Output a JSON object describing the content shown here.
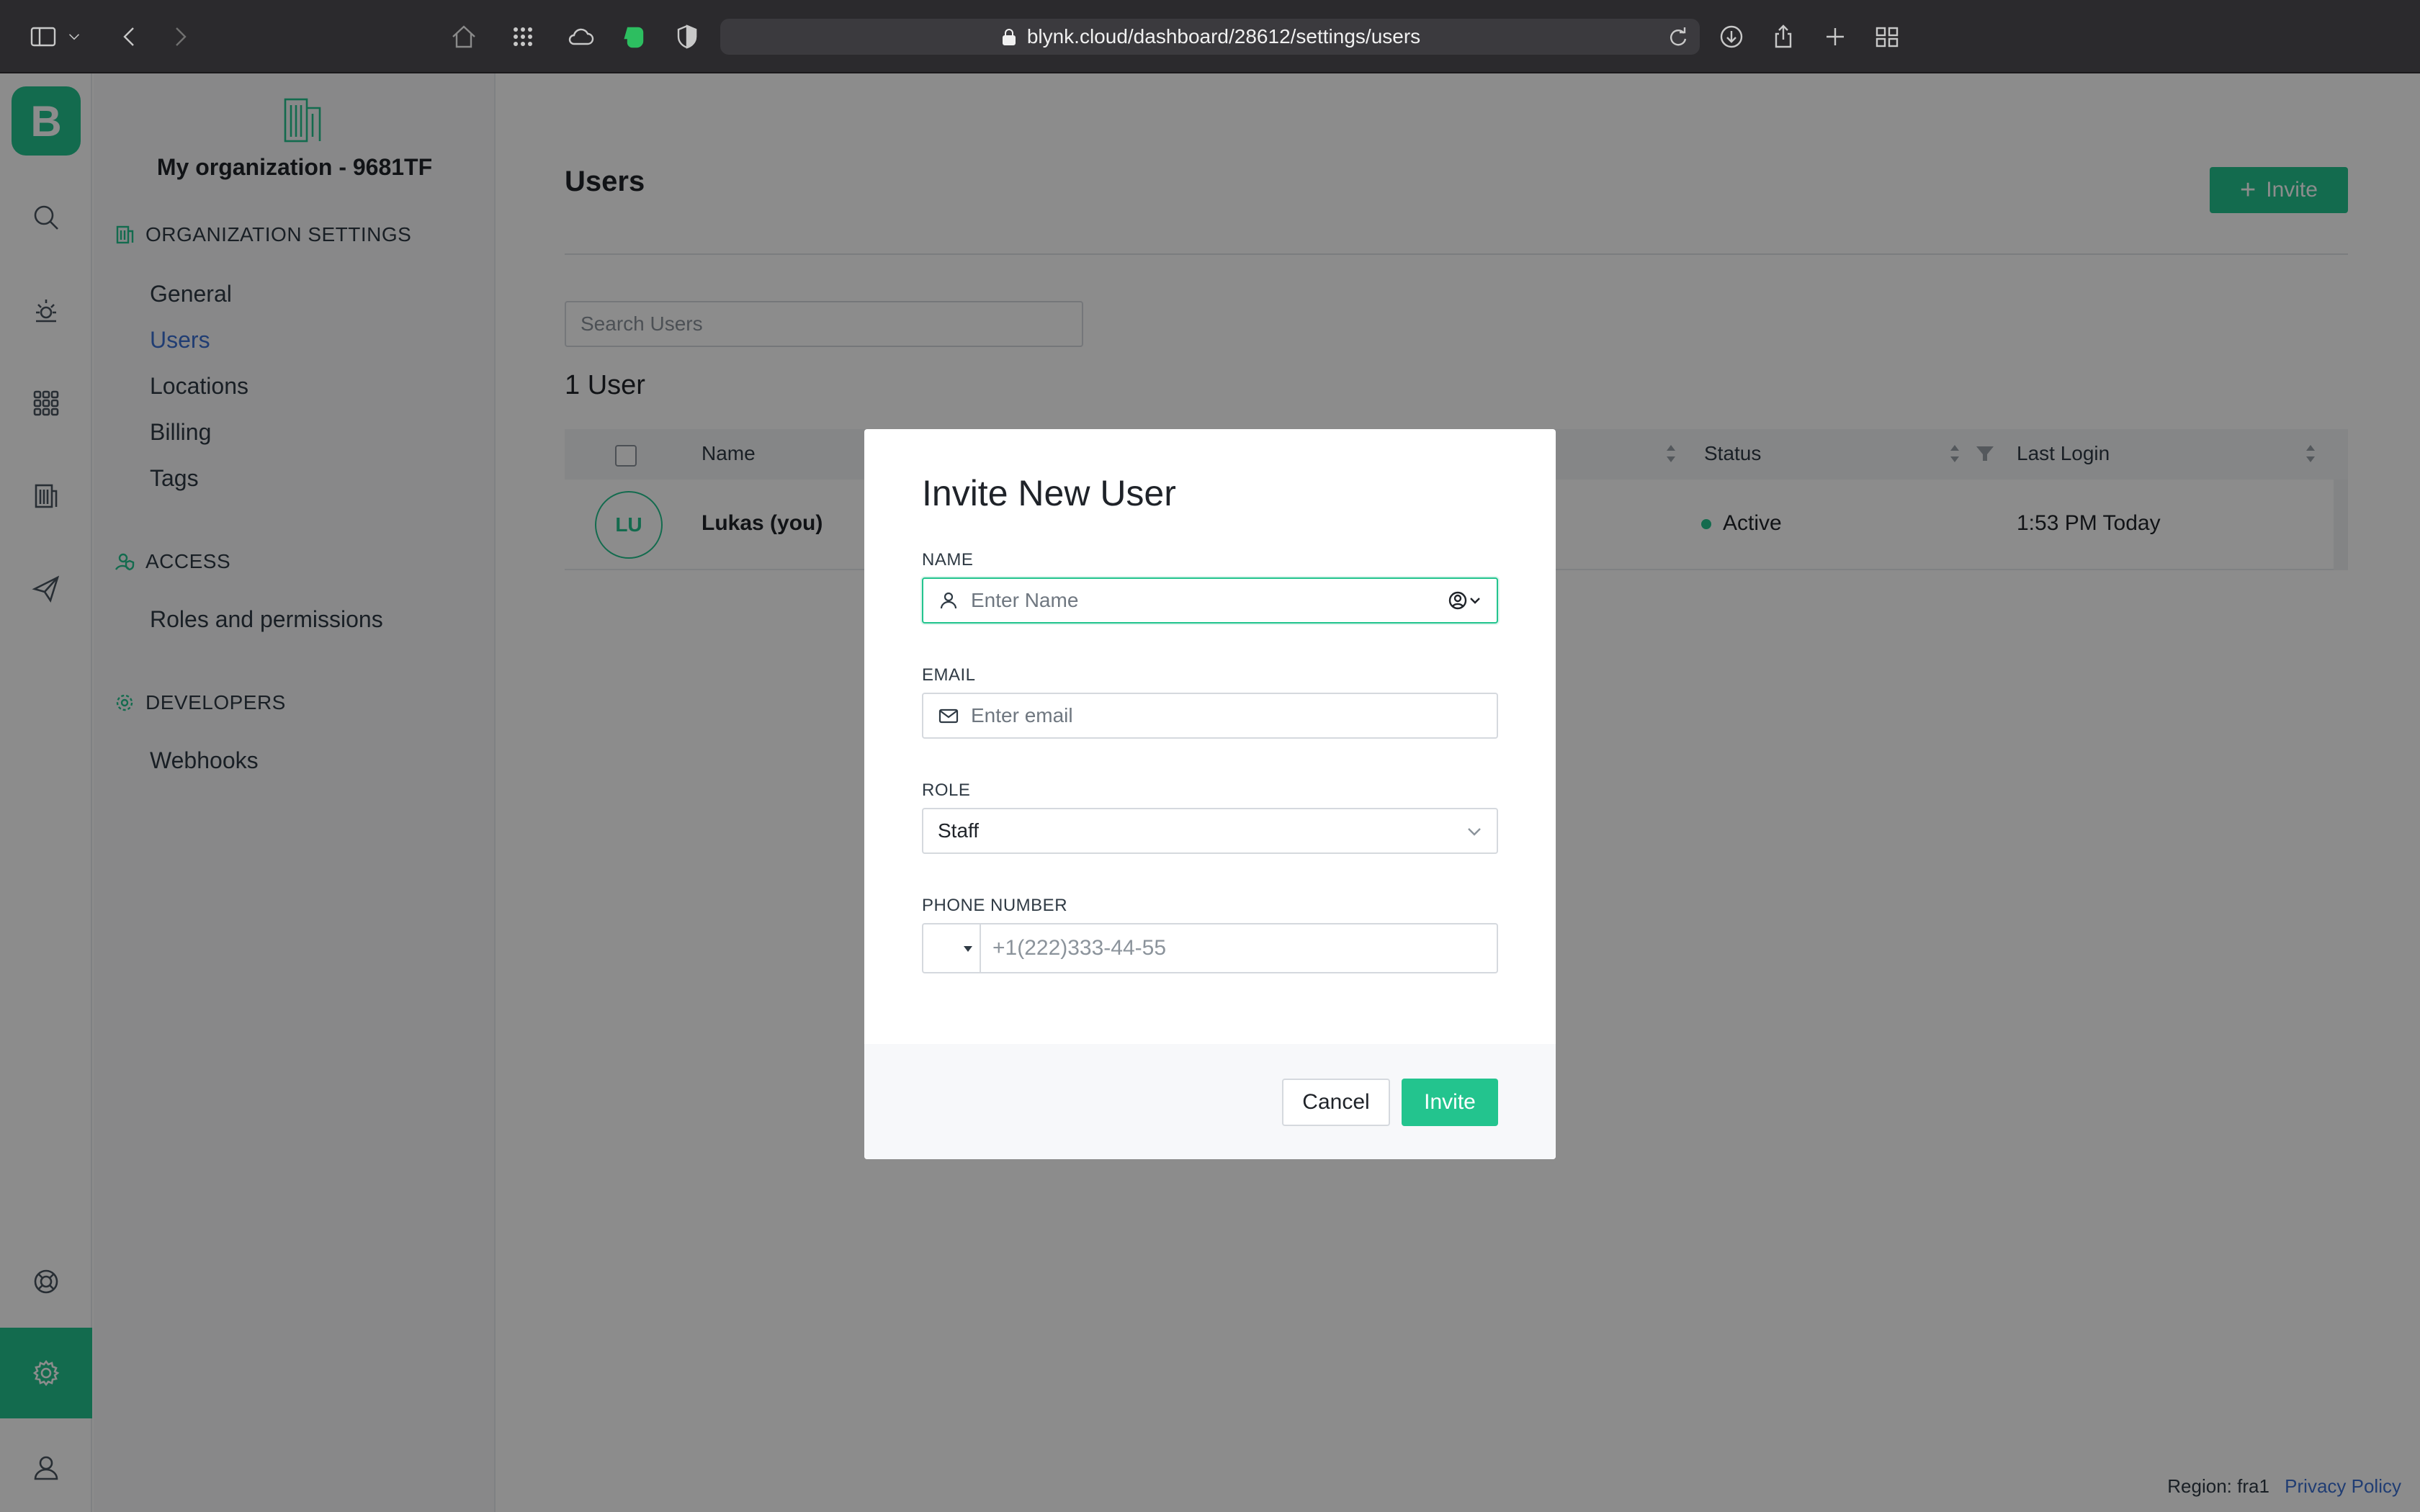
{
  "browser": {
    "url": "blynk.cloud/dashboard/28612/settings/users",
    "icons": [
      "sidebar-toggle-icon",
      "back-icon",
      "forward-icon",
      "home-icon",
      "apps-grid-icon",
      "cloud-icon",
      "evernote-icon",
      "shield-icon",
      "download-icon",
      "share-icon",
      "new-tab-icon",
      "tab-overview-icon"
    ]
  },
  "rail": {
    "logo": "B",
    "icons": [
      "search-icon",
      "dashboard-icon",
      "devices-icon",
      "organization-icon",
      "send-icon",
      "help-icon",
      "settings-icon",
      "user-icon"
    ]
  },
  "sidebar": {
    "org_name": "My organization - 9681TF",
    "sections": [
      {
        "title": "ORGANIZATION SETTINGS",
        "items": [
          "General",
          "Users",
          "Locations",
          "Billing",
          "Tags"
        ]
      },
      {
        "title": "ACCESS",
        "items": [
          "Roles and permissions"
        ]
      },
      {
        "title": "DEVELOPERS",
        "items": [
          "Webhooks"
        ]
      }
    ],
    "active_item": "Users"
  },
  "main": {
    "title": "Users",
    "invite_label": "Invite",
    "search_placeholder": "Search Users",
    "count_label": "1 User",
    "columns": [
      "Name",
      "Status",
      "Last Login"
    ],
    "rows": [
      {
        "initials": "LU",
        "name": "Lukas (you)",
        "status": "Active",
        "last_login": "1:53 PM Today"
      }
    ]
  },
  "modal": {
    "title": "Invite New User",
    "name_label": "NAME",
    "name_placeholder": "Enter Name",
    "email_label": "EMAIL",
    "email_placeholder": "Enter email",
    "role_label": "ROLE",
    "role_value": "Staff",
    "phone_label": "PHONE NUMBER",
    "phone_placeholder": "+1(222)333-44-55",
    "cancel_label": "Cancel",
    "invite_label": "Invite"
  },
  "footer": {
    "region": "Region: fra1",
    "privacy": "Privacy Policy"
  },
  "colors": {
    "accent": "#23c48e",
    "link": "#3b6fd1",
    "chrome": "#2b2a2d"
  }
}
